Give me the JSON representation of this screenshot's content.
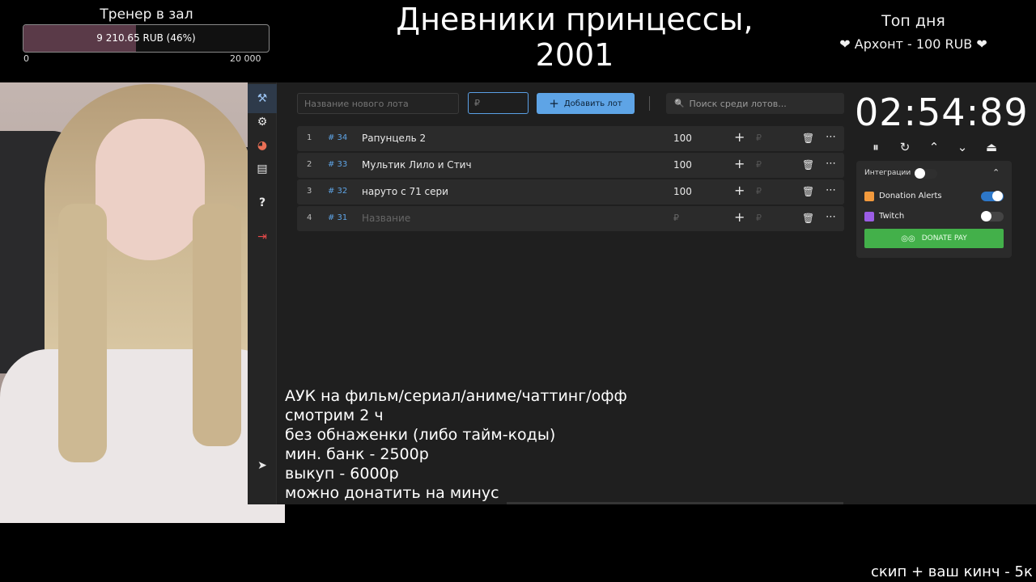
{
  "goal": {
    "title": "Тренер в зал",
    "amount_text": "9 210.65 RUB (46%)",
    "progress": 0.46,
    "min": "0",
    "max": "20 000"
  },
  "stream_title": "Дневники принцессы, 2001",
  "top_day": {
    "title": "Топ дня",
    "line": "❤ Архонт - 100 RUB ❤"
  },
  "sidebar": {
    "items": [
      {
        "name": "gavel-icon",
        "glyph": "⚒"
      },
      {
        "name": "gear-icon",
        "glyph": "⚙"
      },
      {
        "name": "pie-chart-icon",
        "glyph": "◕"
      },
      {
        "name": "clipboard-icon",
        "glyph": "▤"
      },
      {
        "name": "help-icon",
        "glyph": "?"
      },
      {
        "name": "logout-icon",
        "glyph": "⇥"
      },
      {
        "name": "telegram-icon",
        "glyph": "➤"
      }
    ]
  },
  "toolbar": {
    "lot_name_placeholder": "Название нового лота",
    "lot_price_placeholder": "₽",
    "add_label": "Добавить лот",
    "add_icon": "+",
    "search_placeholder": "Поиск среди лотов...",
    "search_icon": "🔍"
  },
  "lots": [
    {
      "index": "1",
      "id": "# 34",
      "name": "Рапунцель 2",
      "amount": "100"
    },
    {
      "index": "2",
      "id": "# 33",
      "name": "Мультик Лило и Стич",
      "amount": "100"
    },
    {
      "index": "3",
      "id": "# 32",
      "name": "наруто с 71 сери",
      "amount": "100"
    },
    {
      "index": "4",
      "id": "# 31",
      "name_placeholder": "Название",
      "amount_placeholder": "₽"
    }
  ],
  "lot_actions": {
    "plus": "+",
    "rub": "₽",
    "trash": "🗑",
    "more": "⋯"
  },
  "timer": {
    "value": "02:54:89",
    "controls": [
      "⏸",
      "↻",
      "⌃",
      "⌄",
      "⏏"
    ]
  },
  "integrations": {
    "title": "Интеграции",
    "chevron": "⌃",
    "items": [
      {
        "label": "Donation Alerts",
        "enabled": true,
        "color": "#f29a3d"
      },
      {
        "label": "Twitch",
        "enabled": false,
        "color": "#9b5de5"
      }
    ],
    "donate_pay_label": "DONATE PAY"
  },
  "rules": [
    "АУК на фильм/сериал/аниме/чаттинг/офф",
    "смотрим 2 ч",
    "без обнаженки (либо тайм-коды)",
    "мин. банк - 2500р",
    "выкуп - 6000р",
    "можно донатить на минус"
  ],
  "bottom_right": "скип + ваш кинч - 5к",
  "colors": {
    "accent": "#5ea4e6",
    "panel": "#1f1f1f",
    "row": "#2b2b2b",
    "donate_pay": "#43b04a",
    "goal_fill": "#5a3a48"
  }
}
